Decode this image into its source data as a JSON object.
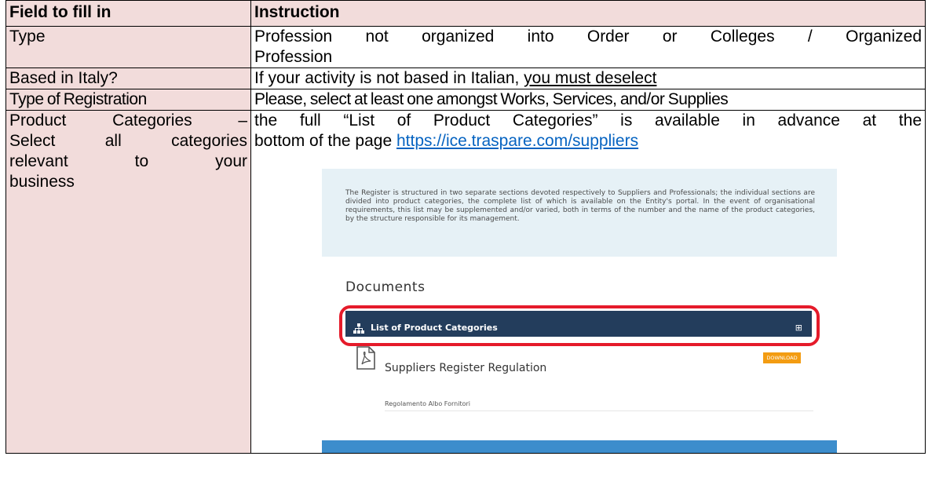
{
  "table": {
    "header": {
      "field": "Field to fill in",
      "instruction": "Instruction"
    },
    "rows": [
      {
        "field": "Type",
        "instruction_line1": "Profession not organized into Order or Colleges / Organized",
        "instruction_line2": "Profession"
      },
      {
        "field": "Based in Italy?",
        "instruction_prefix": "If your activity is not based in Italian, ",
        "instruction_underlined": "you must deselect"
      },
      {
        "field": "Type of Registration",
        "instruction": "Please, select at least one amongst Works, Services, and/or Supplies"
      },
      {
        "field_line1": "Product Categories –",
        "field_line2": "Select all categories",
        "field_line3": "relevant to your",
        "field_line4": "business",
        "instruction_line1": "the full “List of Product Categories” is available in advance at the",
        "instruction_line2_prefix": "bottom of the page ",
        "instruction_link": "https://ice.traspare.com/suppliers"
      }
    ]
  },
  "screenshot": {
    "intro_text": "The Register is structured in two separate sections devoted respectively to Suppliers and Professionals; the individual sections are divided into product categories, the complete list of which is available on the Entity's portal. In the event of organisational requirements, this list may be supplemented and/or varied, both in terms of the number and the name of the product categories, by the structure responsible for its management.",
    "documents_title": "Documents",
    "category_bar_label": "List of Product Categories",
    "category_bar_expand": "⊞",
    "doc_name": "Suppliers Register Regulation",
    "doc_subtitle": "Regolamento Albo Fornitori",
    "download_label": "DOWNLOAD",
    "colors": {
      "intro_bg": "#e6f1f6",
      "bar_bg": "#233d5c",
      "highlight": "#e51b2a",
      "download": "#f39c12",
      "footer_bar": "#3c8dcc"
    }
  }
}
